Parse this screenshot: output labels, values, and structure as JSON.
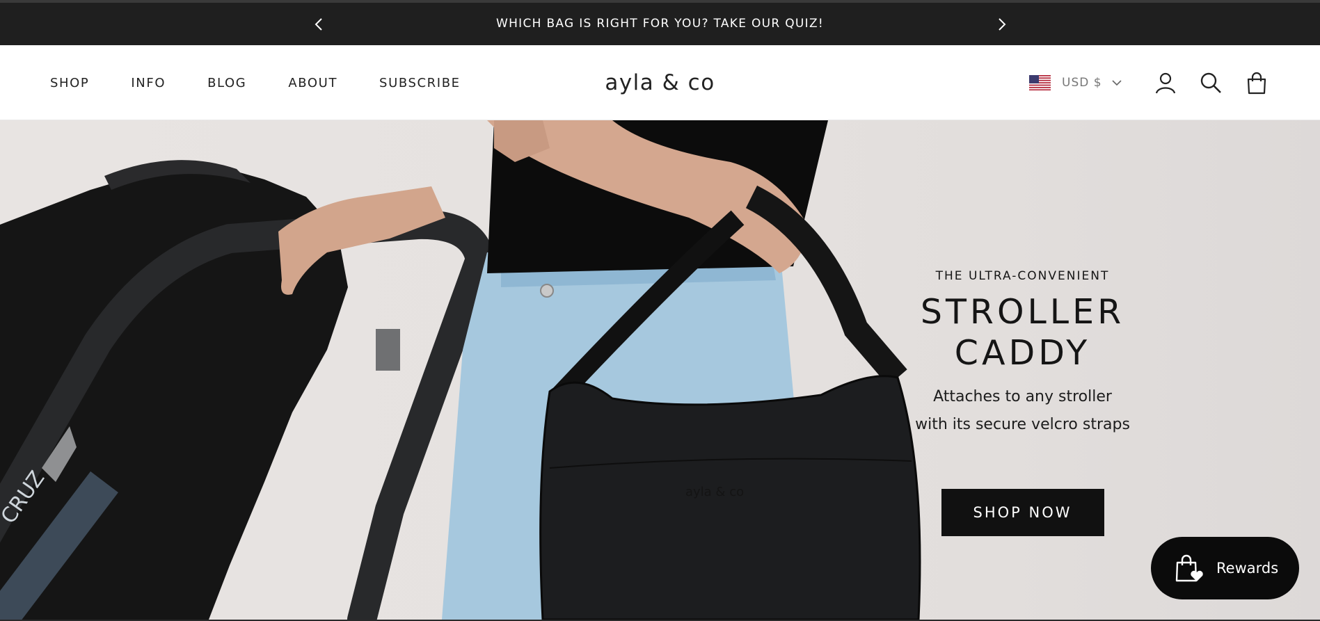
{
  "announcement": {
    "message": "WHICH BAG IS RIGHT FOR YOU? TAKE OUR QUIZ!",
    "prev_icon": "chevron-left-icon",
    "next_icon": "chevron-right-icon"
  },
  "header": {
    "nav": [
      "SHOP",
      "INFO",
      "BLOG",
      "ABOUT",
      "SUBSCRIBE"
    ],
    "logo": "ayla & co",
    "currency": {
      "label": "USD $",
      "flag_icon": "us-flag-icon",
      "dropdown_icon": "chevron-down-icon"
    },
    "icons": [
      "account-icon",
      "search-icon",
      "cart-bag-icon"
    ]
  },
  "hero": {
    "eyebrow": "THE ULTRA-CONVENIENT",
    "headline_line1": "STROLLER",
    "headline_line2": "CADDY",
    "sub_line1": "Attaches to any stroller",
    "sub_line2": "with its secure velcro straps",
    "cta": "SHOP NOW",
    "bag_imprint": "ayla & co",
    "stroller_text": "CRUZ"
  },
  "rewards": {
    "label": "Rewards",
    "icon": "shopping-bag-heart-icon"
  },
  "colors": {
    "announcement_bg": "#1f1f1f",
    "button_bg": "#111111",
    "hero_bg": "#e6e2e0",
    "denim": "#9ec3dc"
  }
}
